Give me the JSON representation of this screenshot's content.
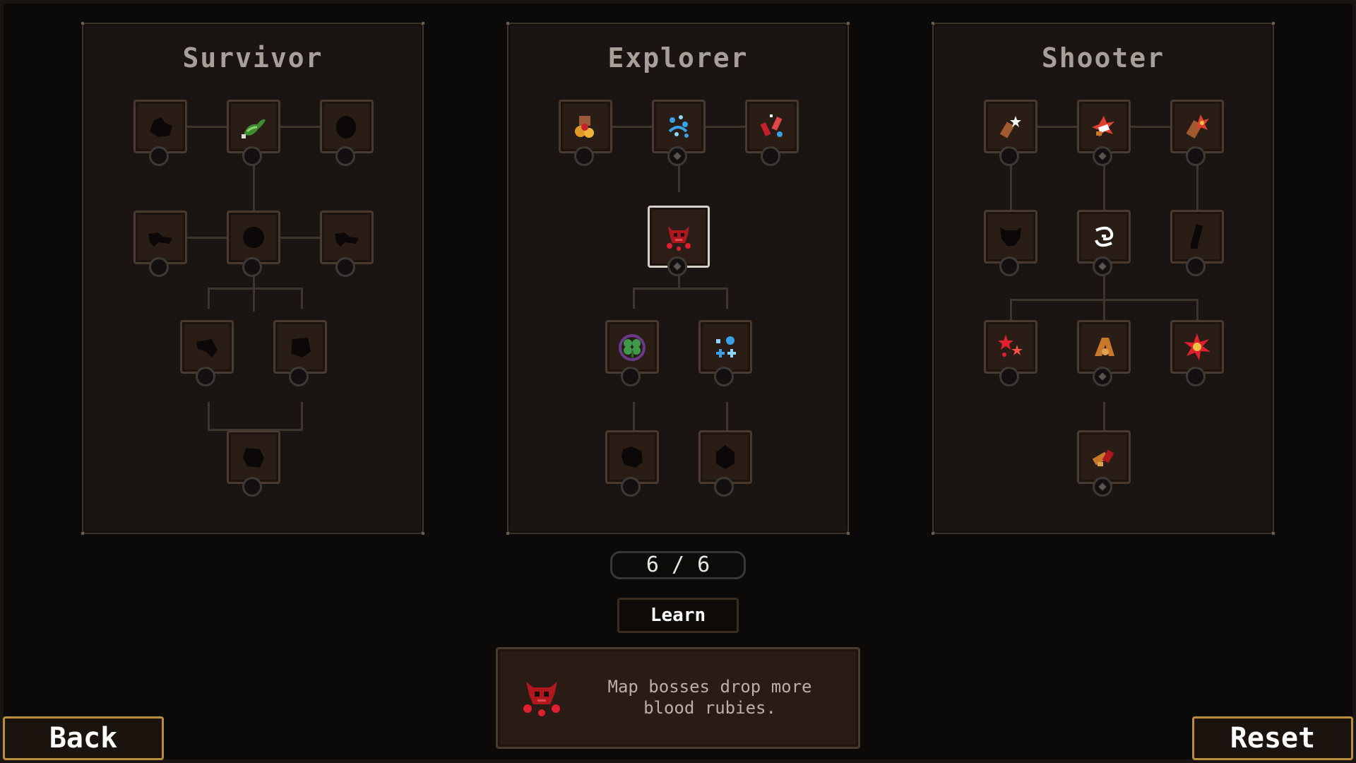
{
  "panels": [
    {
      "title": "Survivor"
    },
    {
      "title": "Explorer"
    },
    {
      "title": "Shooter"
    }
  ],
  "nodes": {
    "survivor": [
      "locked-skill-icon",
      "serpent-skill-icon",
      "locked-skill-icon",
      "locked-skill-icon",
      "locked-skill-icon",
      "locked-skill-icon",
      "locked-skill-icon",
      "locked-skill-icon",
      "locked-skill-icon"
    ],
    "explorer": [
      "coins-skill-icon",
      "water-droplets-skill-icon",
      "potions-skill-icon",
      "demon-skull-skill-icon",
      "clover-skill-icon",
      "blue-gems-skill-icon",
      "locked-skill-icon",
      "locked-skill-icon"
    ],
    "shooter": [
      "bullet-spark-skill-icon",
      "explosion-bullet-skill-icon",
      "fire-bullet-skill-icon",
      "locked-skill-icon",
      "whirl-skill-icon",
      "locked-skill-icon",
      "red-sparks-skill-icon",
      "ricochet-skill-icon",
      "burst-skill-icon",
      "shell-casing-skill-icon"
    ]
  },
  "points": {
    "text": "6 / 6",
    "current": 6,
    "max": 6
  },
  "learn_label": "Learn",
  "description": {
    "icon": "demon-skull-icon",
    "text": "Map bosses drop more blood rubies."
  },
  "back_label": "Back",
  "reset_label": "Reset",
  "colors": {
    "accent_gold": "#b88e3c",
    "panel_bg": "#1a1512",
    "node_bg": "#2a1d16",
    "ruby_red": "#c8202a"
  }
}
